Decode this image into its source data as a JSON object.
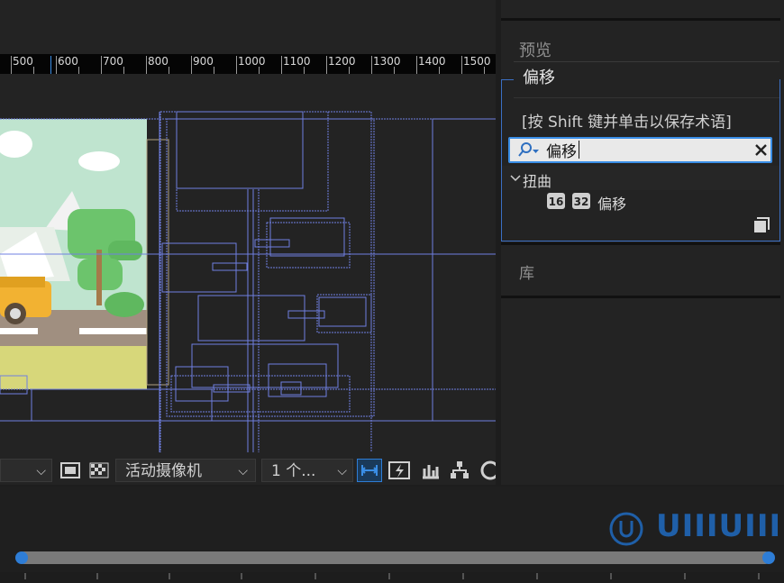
{
  "ruler": {
    "labels": [
      "500",
      "600",
      "700",
      "800",
      "900",
      "1000",
      "1100",
      "1200",
      "1300",
      "1400",
      "1500"
    ]
  },
  "toolbar": {
    "camera_label": "活动摄像机",
    "view_count_label": "1 个..."
  },
  "right_panel": {
    "preview_label": "预览",
    "library_label": "库",
    "popup_title": "偏移",
    "popup_hint": "[按 Shift 键并单击以保存术语]",
    "search_value": "偏移",
    "category": "扭曲",
    "effect_name": "偏移"
  },
  "watermark": {
    "text": "UIIIUIII"
  },
  "colors": {
    "accent": "#3a8ee6",
    "guide": "#6f7fe0",
    "scrubber": "#2e7dd6"
  }
}
